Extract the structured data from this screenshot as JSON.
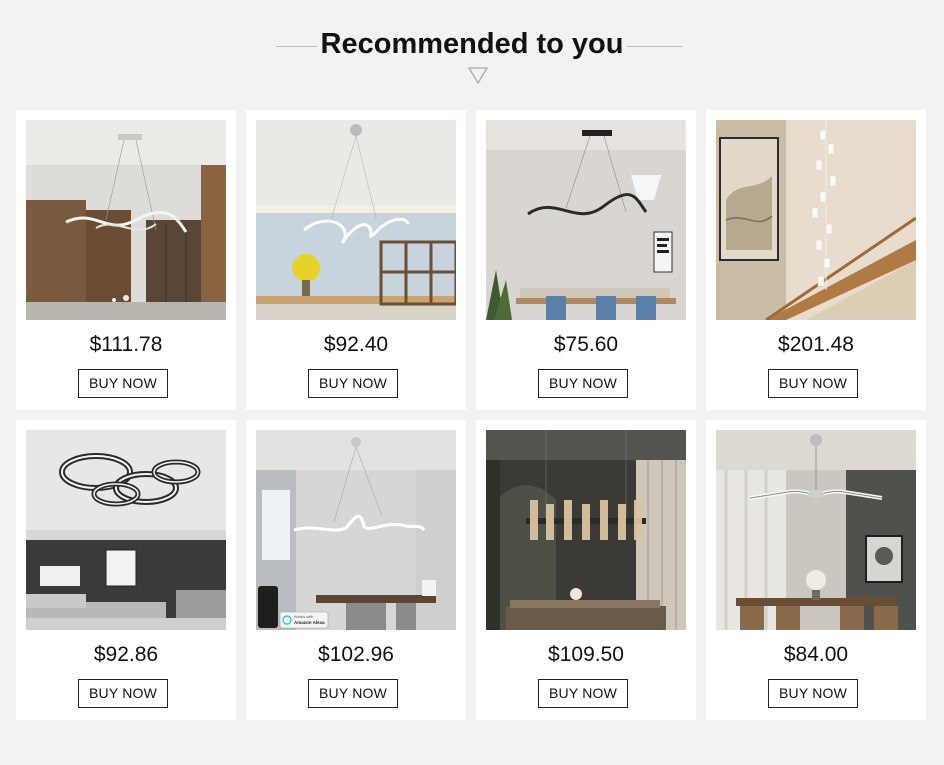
{
  "header": {
    "title": "Recommended to you"
  },
  "products": [
    {
      "price": "$111.78",
      "button": "BUY NOW",
      "image": "wave-pendant-light-walnut-kitchen"
    },
    {
      "price": "$92.40",
      "button": "BUY NOW",
      "image": "scribble-led-pendant-shelves"
    },
    {
      "price": "$75.60",
      "button": "BUY NOW",
      "image": "black-wave-pendant-dining"
    },
    {
      "price": "$201.48",
      "button": "BUY NOW",
      "image": "crystal-staircase-chandelier"
    },
    {
      "price": "$92.86",
      "button": "BUY NOW",
      "image": "ring-ceiling-light-living-room"
    },
    {
      "price": "$102.96",
      "button": "BUY NOW",
      "image": "wave-pendant-with-smart-speaker",
      "sign": {
        "line1": "Works with",
        "line2": "Amazon Alexa"
      }
    },
    {
      "price": "$109.50",
      "button": "BUY NOW",
      "image": "crystal-linear-chandelier-dining"
    },
    {
      "price": "$84.00",
      "button": "BUY NOW",
      "image": "three-arm-led-pendant-dining"
    }
  ],
  "colors": {
    "background": "#f2f2f2",
    "card": "#ffffff",
    "text": "#111111"
  }
}
